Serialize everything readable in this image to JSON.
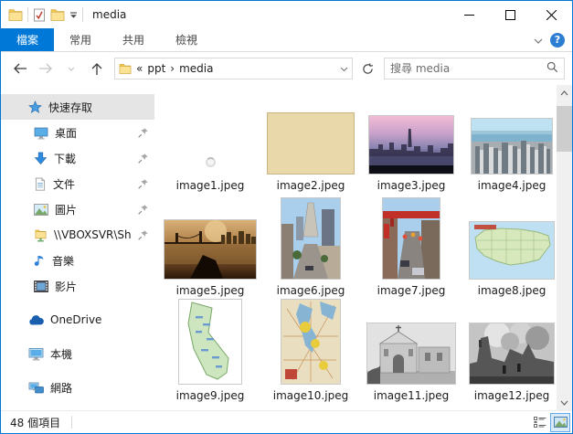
{
  "window": {
    "title": "media"
  },
  "colors": {
    "accent": "#0078d7",
    "sidebar_selection": "#e5e5e5",
    "blank_image_tan": "#e9d8a9"
  },
  "ribbon": {
    "tabs": [
      {
        "label": "檔案",
        "active": true
      },
      {
        "label": "常用",
        "active": false
      },
      {
        "label": "共用",
        "active": false
      },
      {
        "label": "檢視",
        "active": false
      }
    ],
    "help_glyph": "?"
  },
  "address_bar": {
    "collapsed_glyph": "«",
    "separator_glyph": "›",
    "path_segments": [
      "ppt",
      "media"
    ],
    "search_placeholder": "搜尋 media"
  },
  "sidebar": {
    "items": [
      {
        "label": "快速存取",
        "icon": "quick-access-star",
        "selected": true,
        "pinned": false
      },
      {
        "label": "桌面",
        "icon": "desktop",
        "selected": false,
        "pinned": true
      },
      {
        "label": "下載",
        "icon": "downloads-arrow",
        "selected": false,
        "pinned": true
      },
      {
        "label": "文件",
        "icon": "documents",
        "selected": false,
        "pinned": true
      },
      {
        "label": "圖片",
        "icon": "pictures",
        "selected": false,
        "pinned": true
      },
      {
        "label": "\\\\VBOXSVR\\Sh",
        "icon": "network-drive",
        "selected": false,
        "pinned": true
      },
      {
        "label": "音樂",
        "icon": "music-note",
        "selected": false,
        "pinned": false
      },
      {
        "label": "影片",
        "icon": "videos-film",
        "selected": false,
        "pinned": false
      },
      {
        "label": "OneDrive",
        "icon": "onedrive-cloud",
        "selected": false,
        "pinned": false
      },
      {
        "label": "本機",
        "icon": "this-pc",
        "selected": false,
        "pinned": false
      },
      {
        "label": "網路",
        "icon": "network",
        "selected": false,
        "pinned": false
      }
    ]
  },
  "files": [
    {
      "name": "image1.jpeg",
      "desc": "thumbnail loading spinner"
    },
    {
      "name": "image2.jpeg",
      "desc": "plain tan blank image"
    },
    {
      "name": "image3.jpeg",
      "desc": "city skyline at dusk, pink-purple sky"
    },
    {
      "name": "image4.jpeg",
      "desc": "aerial view of downtown and bay"
    },
    {
      "name": "image5.jpeg",
      "desc": "sepia bay bridge at sunset"
    },
    {
      "name": "image6.jpeg",
      "desc": "street view with pyramid tower, portrait"
    },
    {
      "name": "image7.jpeg",
      "desc": "chinatown street with red overpass, portrait"
    },
    {
      "name": "image8.jpeg",
      "desc": "map of the United States"
    },
    {
      "name": "image9.jpeg",
      "desc": "map of California, portrait"
    },
    {
      "name": "image10.jpeg",
      "desc": "bay area road map, portrait"
    },
    {
      "name": "image11.jpeg",
      "desc": "grayscale photo of mission church"
    },
    {
      "name": "image12.jpeg",
      "desc": "grayscale photo of earthquake fire ruins"
    }
  ],
  "status_bar": {
    "items_count": "48 個項目"
  }
}
